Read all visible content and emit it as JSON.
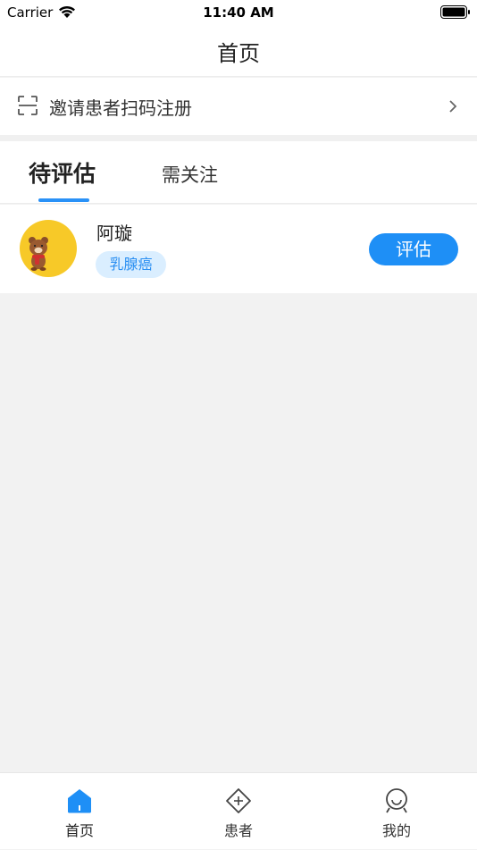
{
  "status_bar": {
    "carrier": "Carrier",
    "time": "11:40 AM"
  },
  "nav": {
    "title": "首页"
  },
  "invite": {
    "label": "邀请患者扫码注册"
  },
  "tabs": [
    {
      "label": "待评估",
      "active": true
    },
    {
      "label": "需关注",
      "active": false
    }
  ],
  "patients": [
    {
      "name": "阿璇",
      "tag": "乳腺癌",
      "action_label": "评估"
    }
  ],
  "tab_bar": [
    {
      "label": "首页",
      "icon": "home-icon",
      "active": true
    },
    {
      "label": "患者",
      "icon": "patient-icon",
      "active": false
    },
    {
      "label": "我的",
      "icon": "profile-icon",
      "active": false
    }
  ],
  "colors": {
    "accent": "#1e8ff6",
    "tag_bg": "#daeeff",
    "avatar_bg": "#f7c928",
    "background": "#f2f2f2"
  }
}
